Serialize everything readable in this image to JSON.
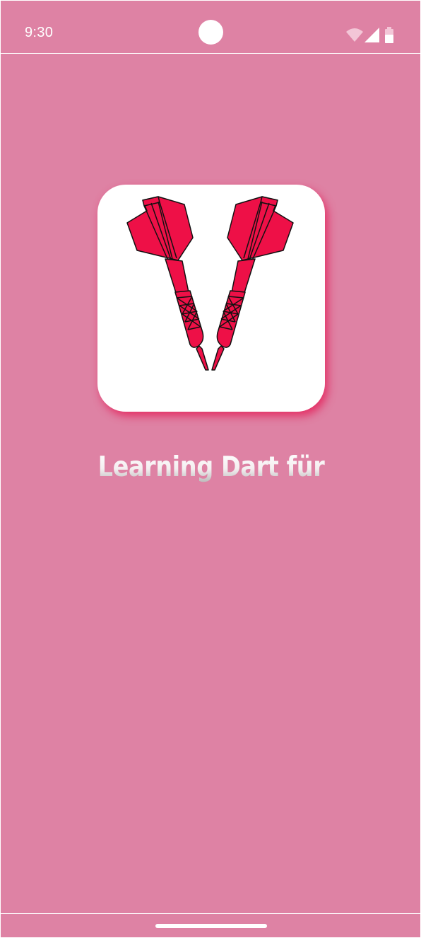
{
  "status_bar": {
    "time": "9:30",
    "icons": [
      "wifi-icon",
      "signal-icon",
      "battery-icon"
    ]
  },
  "app": {
    "title": "Learning Dart für",
    "icon": "crossed-darts-icon"
  },
  "colors": {
    "background": "#de82a4",
    "dart": "#ee1047",
    "card": "#ffffff",
    "shadow": "#e61450"
  }
}
